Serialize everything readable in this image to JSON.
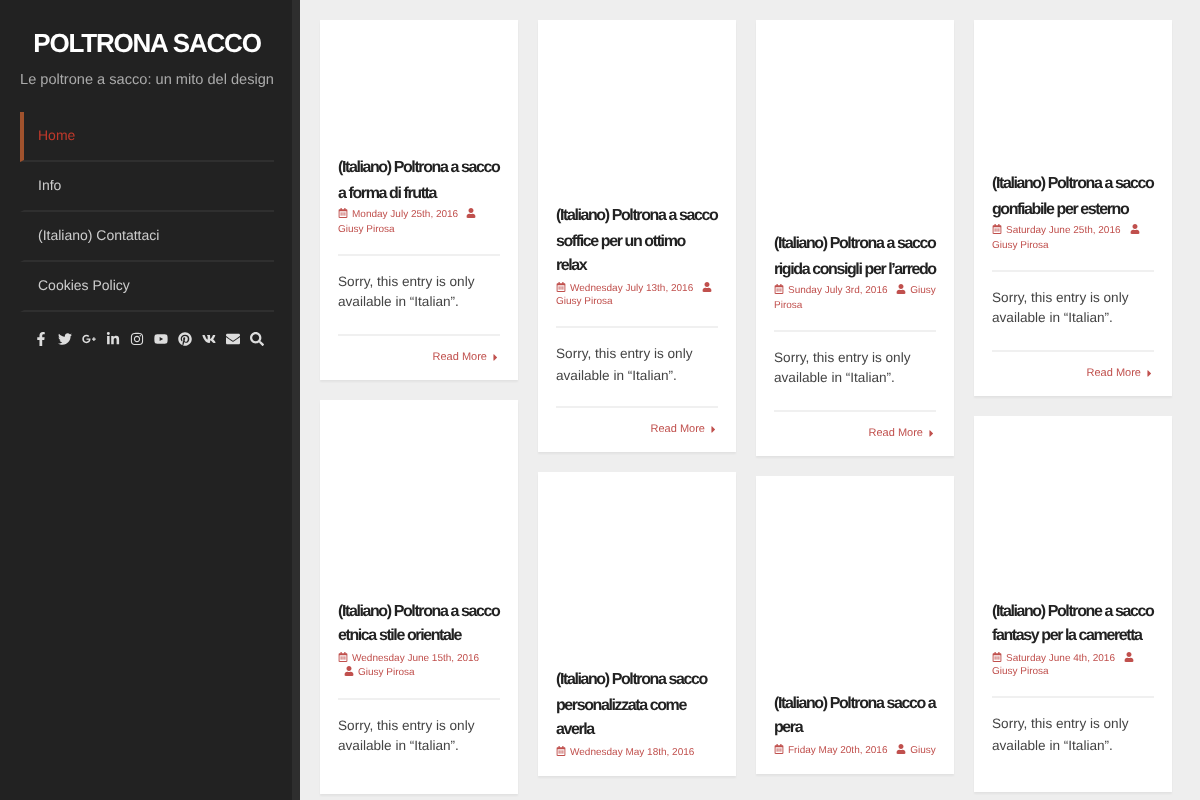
{
  "sidebar": {
    "site_title": "POLTRONA SACCO",
    "tagline": "Le poltrone a sacco: un mito del design",
    "menu": [
      {
        "label": "Home",
        "selected": true
      },
      {
        "label": "Info",
        "selected": false
      },
      {
        "label": "(Italiano) Contattaci",
        "selected": false
      },
      {
        "label": "Cookies Policy",
        "selected": false
      }
    ],
    "social": [
      {
        "kind": "facebook"
      },
      {
        "kind": "twitter"
      },
      {
        "kind": "googleplus"
      },
      {
        "kind": "linkedin"
      },
      {
        "kind": "instagram"
      },
      {
        "kind": "youtube"
      },
      {
        "kind": "pinterest"
      },
      {
        "kind": "vk"
      },
      {
        "kind": "email"
      },
      {
        "kind": "search"
      }
    ]
  },
  "columns": [
    {
      "posts": [
        {
          "title": "(Italiano) Poltrona a sacco a forma di frutta",
          "date": "Monday July 25th, 2016",
          "author": "Giusy Pirosa",
          "excerpt": "Sorry, this entry is only available in “Italian”.",
          "read_more": "Read More"
        },
        {
          "title": "(Italiano) Poltrona a sacco etnica stile orientale",
          "date": "Wednesday June 15th, 2016",
          "author": "Giusy Pirosa",
          "excerpt": "Sorry, this entry is only available in “Italian”."
        }
      ]
    },
    {
      "posts": [
        {
          "title": "(Italiano) Poltrona a sacco soffice per un ottimo relax",
          "date": "Wednesday July 13th, 2016",
          "author": "Giusy Pirosa",
          "excerpt": "Sorry, this entry is only available in “Italian”.",
          "read_more": "Read More"
        },
        {
          "title": "(Italiano) Poltrona sacco personalizzata come averla",
          "date": "Wednesday May 18th, 2016"
        }
      ]
    },
    {
      "posts": [
        {
          "title": "(Italiano) Poltrona a sacco rigida consigli per l’arredo",
          "date": "Sunday July 3rd, 2016",
          "author": "Giusy Pirosa",
          "excerpt": "Sorry, this entry is only available in “Italian”.",
          "read_more": "Read More"
        },
        {
          "title": "(Italiano) Poltrona sacco a pera",
          "date": "Friday May 20th, 2016",
          "author": "Giusy"
        }
      ]
    },
    {
      "posts": [
        {
          "title": "(Italiano) Poltrona a sacco gonfiabile per esterno",
          "date": "Saturday June 25th, 2016",
          "author": "Giusy Pirosa",
          "excerpt": "Sorry, this entry is only available in “Italian”.",
          "read_more": "Read More"
        },
        {
          "title": "(Italiano) Poltrone a sacco fantasy per la cameretta",
          "date": "Saturday June 4th, 2016",
          "author": "Giusy Pirosa",
          "excerpt": "Sorry, this entry is only available in “Italian”."
        }
      ]
    }
  ]
}
